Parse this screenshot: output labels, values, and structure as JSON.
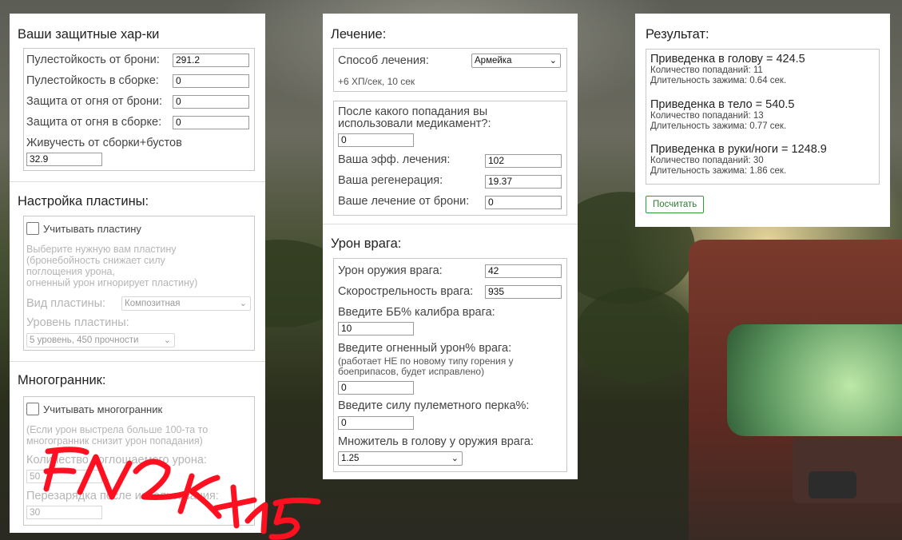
{
  "defense": {
    "title": "Ваши защитные хар-ки",
    "rows": [
      {
        "label": "Пулестойкость от брони:",
        "value": "291.2"
      },
      {
        "label": "Пулестойкость в сборке:",
        "value": "0"
      },
      {
        "label": "Защита от огня от брони:",
        "value": "0"
      },
      {
        "label": "Защита от огня в сборке:",
        "value": "0"
      }
    ],
    "vitality_label": "Живучесть от сборки+бустов",
    "vitality_value": "32.9"
  },
  "plate": {
    "title": "Настройка пластины:",
    "checkbox_label": "Учитывать пластину",
    "desc": [
      "Выберите нужную вам пластину",
      "(бронебойность снижает силу",
      "поглощения урона,",
      "огненный урон игнорирует пластину)"
    ],
    "type_label": "Вид пластины:",
    "type_value": "Композитная",
    "level_label": "Уровень пластины:",
    "level_value": "5 уровень, 450 прочности"
  },
  "polyhedron": {
    "title": "Многогранник:",
    "checkbox_label": "Учитывать многогранник",
    "desc": [
      "(Если урон выстрела больше 100-та то",
      "многогранник снизит урон попадания)"
    ],
    "absorb_label": "Количество поглощаемого урона:",
    "absorb_value": "50",
    "reload_label": "Перезарядка после использования:",
    "reload_value": "30"
  },
  "healing": {
    "title": "Лечение:",
    "method_label": "Способ лечения:",
    "method_value": "Армейка",
    "method_note": "+6 ХП/сек, 10 сек",
    "question": [
      "После какого попадания вы",
      "использовали медикамент?:"
    ],
    "question_value": "0",
    "rows": [
      {
        "label": "Ваша эфф. лечения:",
        "value": "102"
      },
      {
        "label": "Ваша регенерация:",
        "value": "19.37"
      },
      {
        "label": "Ваше лечение от брони:",
        "value": "0"
      }
    ]
  },
  "enemy": {
    "title": "Урон врага:",
    "rows": [
      {
        "label": "Урон оружия врага:",
        "value": "42"
      },
      {
        "label": "Скорострельность врага:",
        "value": "935"
      }
    ],
    "pen_label": "Введите ББ% калибра врага:",
    "pen_value": "10",
    "fire_label": "Введите огненный урон% врага:",
    "fire_note": [
      "(работает НЕ по новому типу горения у",
      "боеприпасов, будет исправлено)"
    ],
    "fire_value": "0",
    "mg_label": "Введите силу пулеметного перка%:",
    "mg_value": "0",
    "head_label": "Множитель в голову у оружия врага:",
    "head_value": "1.25"
  },
  "result": {
    "title": "Результат:",
    "blocks": [
      {
        "head": "Приведенка в голову = 424.5",
        "hits": "Количество попаданий: 11",
        "dur": "Длительность зажима: 0.64 сек."
      },
      {
        "head": "Приведенка в тело = 540.5",
        "hits": "Количество попаданий: 13",
        "dur": "Длительность зажима: 0.77 сек."
      },
      {
        "head": "Приведенка в руки/ноги = 1248.9",
        "hits": "Количество попаданий: 30",
        "dur": "Длительность зажима: 1.86 сек."
      }
    ],
    "button": "Посчитать"
  },
  "colors": {
    "accent_green": "#2e9a3a",
    "scribble_red": "#ff1020"
  }
}
